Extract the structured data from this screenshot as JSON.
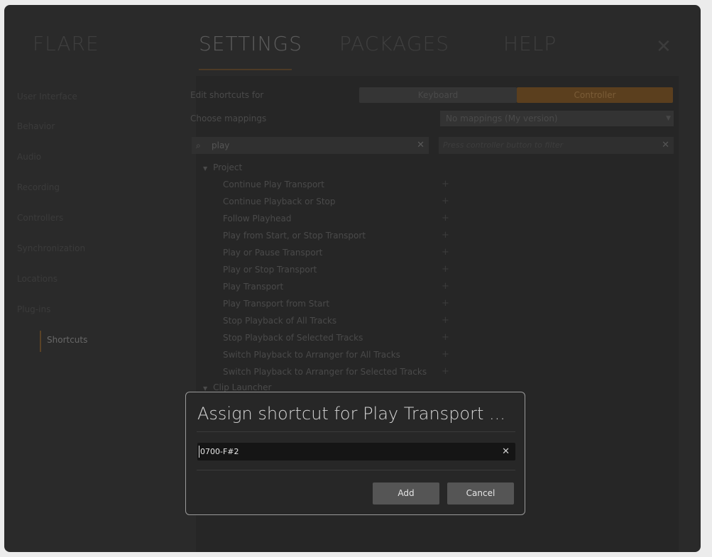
{
  "tabs": {
    "flare": "FLARE",
    "settings": "SETTINGS",
    "packages": "PACKAGES",
    "help": "HELP",
    "close": "✕"
  },
  "sidebar": {
    "items": [
      {
        "label": "User Interface"
      },
      {
        "label": "Behavior"
      },
      {
        "label": "Audio"
      },
      {
        "label": "Recording"
      },
      {
        "label": "Controllers"
      },
      {
        "label": "Synchronization"
      },
      {
        "label": "Locations"
      },
      {
        "label": "Plug-ins"
      },
      {
        "label": "Shortcuts"
      }
    ],
    "active": "Shortcuts"
  },
  "shortcuts": {
    "edit_label": "Edit shortcuts for",
    "mode_keyboard": "Keyboard",
    "mode_controller": "Controller",
    "mappings_label": "Choose mappings",
    "mappings_value": "No mappings (My version)",
    "search_value": "play",
    "filter_placeholder": "Press controller button to filter",
    "groups": [
      {
        "name": "Project",
        "commands": [
          "Continue Play Transport",
          "Continue Playback or Stop",
          "Follow Playhead",
          "Play from Start, or Stop Transport",
          "Play or Pause Transport",
          "Play or Stop Transport",
          "Play Transport",
          "Play Transport from Start",
          "Stop Playback of All Tracks",
          "Stop Playback of Selected Tracks",
          "Switch Playback to Arranger for All Tracks",
          "Switch Playback to Arranger for Selected Tracks"
        ]
      },
      {
        "name": "Clip Launcher",
        "commands": []
      }
    ],
    "add_symbol": "+"
  },
  "modal": {
    "title": "Assign shortcut for Play Transport ...",
    "input_value": "0700-F#2",
    "clear_symbol": "✕",
    "add_label": "Add",
    "cancel_label": "Cancel"
  },
  "colors": {
    "accent": "#5b3f1e",
    "background": "#2a2a2a"
  }
}
